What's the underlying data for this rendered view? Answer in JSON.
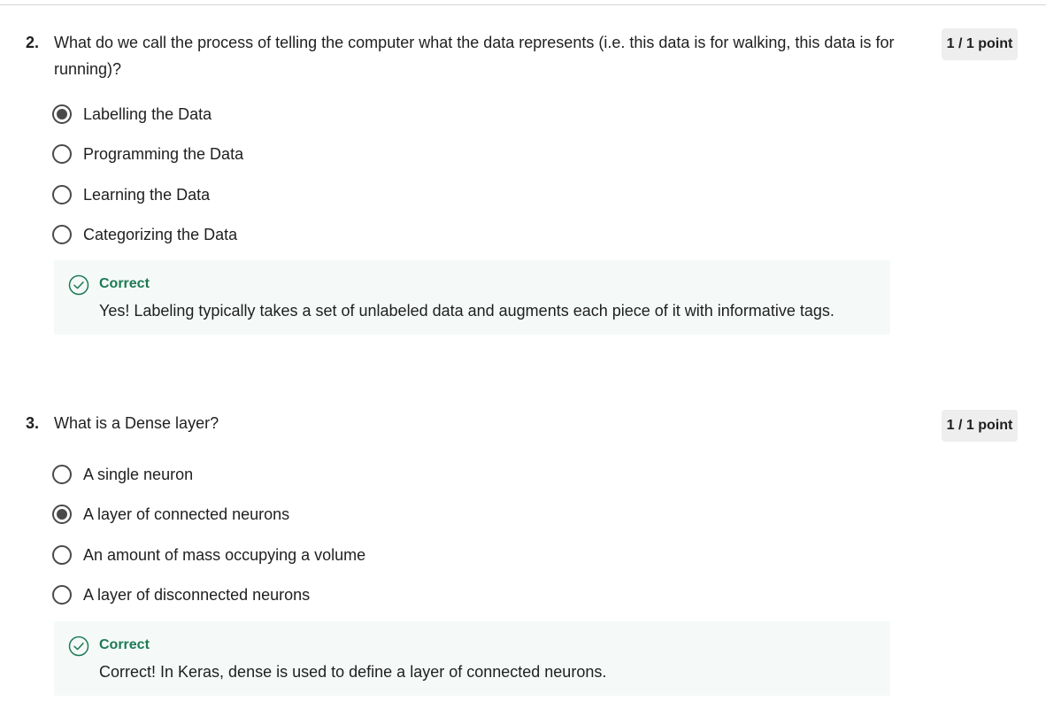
{
  "questions": [
    {
      "number": "2.",
      "text": "What do we call the process of telling the computer what the data represents (i.e. this data is for walking, this data is for running)?",
      "points": "1 / 1 point",
      "options": [
        {
          "label": "Labelling the Data",
          "selected": true
        },
        {
          "label": "Programming the Data",
          "selected": false
        },
        {
          "label": "Learning the Data",
          "selected": false
        },
        {
          "label": "Categorizing the Data",
          "selected": false
        }
      ],
      "feedback": {
        "title": "Correct",
        "text": "Yes! Labeling typically takes a set of unlabeled data and augments each piece of it with informative tags."
      }
    },
    {
      "number": "3.",
      "text": "What is a Dense layer?",
      "points": "1 / 1 point",
      "options": [
        {
          "label": "A single neuron",
          "selected": false
        },
        {
          "label": "A layer of connected neurons",
          "selected": true
        },
        {
          "label": "An amount of mass occupying a volume",
          "selected": false
        },
        {
          "label": "A layer of disconnected neurons",
          "selected": false
        }
      ],
      "feedback": {
        "title": "Correct",
        "text": "Correct! In Keras, dense is used to define a layer of connected neurons."
      }
    }
  ],
  "colors": {
    "correct": "#1d7a55",
    "feedback_bg": "#f5faf8",
    "radio": "#4a4a4a",
    "points_bg": "#eeeeee"
  },
  "icons": {
    "radio_selected": "radio-selected-icon",
    "radio_unselected": "radio-unselected-icon",
    "feedback": "check-circle-icon"
  }
}
